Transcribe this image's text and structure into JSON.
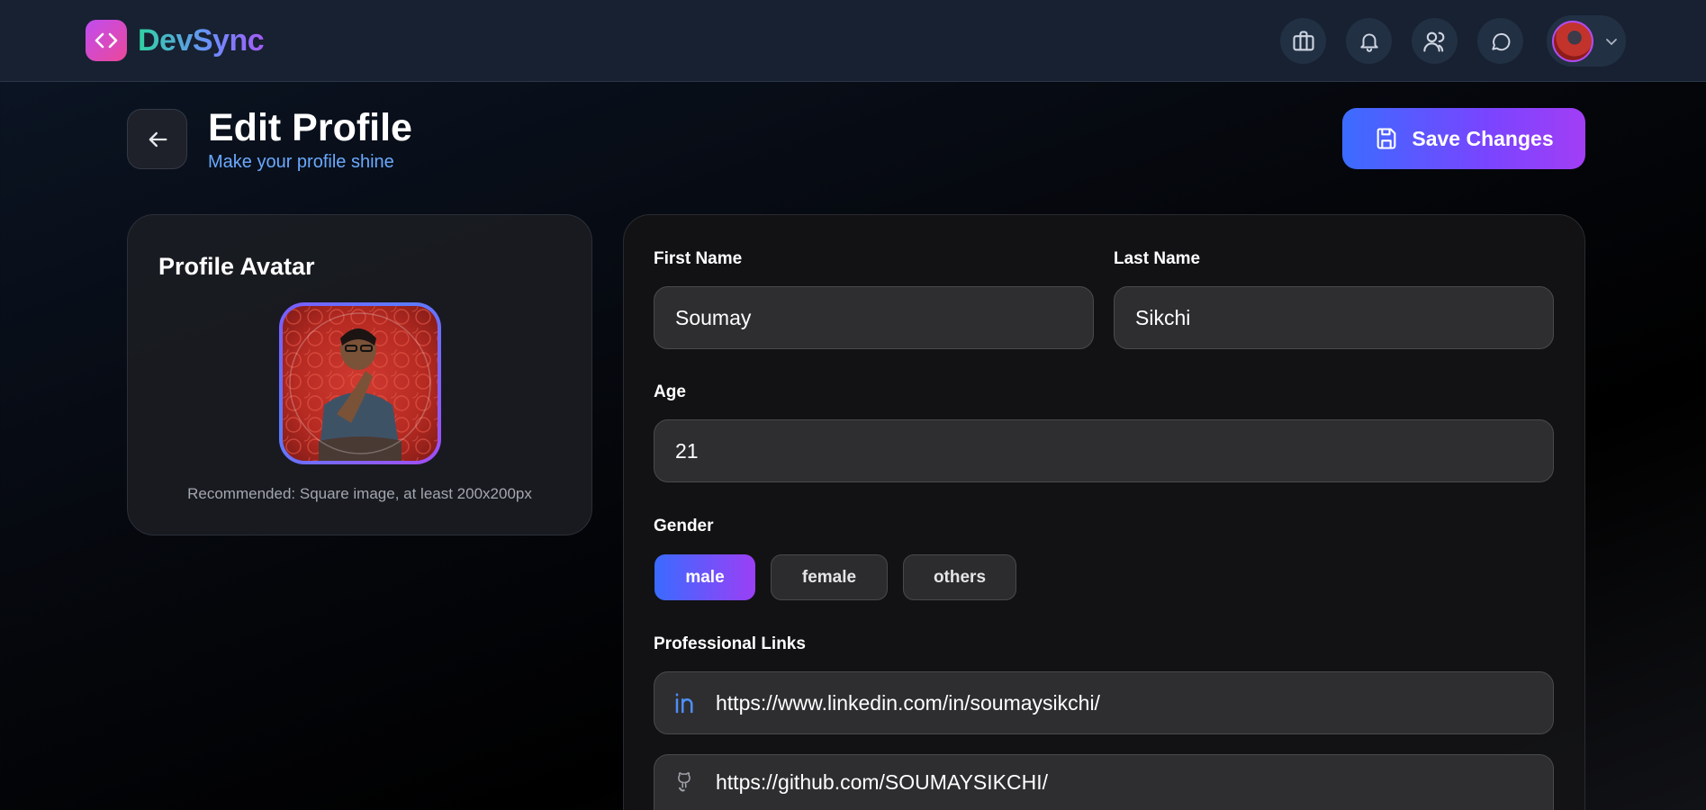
{
  "app": {
    "name": "DevSync"
  },
  "header": {
    "title": "Edit Profile",
    "subtitle": "Make your profile shine",
    "save_label": "Save Changes"
  },
  "nav": {
    "icons": [
      "briefcase-icon",
      "bell-icon",
      "users-icon",
      "chat-icon"
    ]
  },
  "avatar_card": {
    "title": "Profile Avatar",
    "hint": "Recommended: Square image, at least 200x200px"
  },
  "form": {
    "first_name": {
      "label": "First Name",
      "value": "Soumay"
    },
    "last_name": {
      "label": "Last Name",
      "value": "Sikchi"
    },
    "age": {
      "label": "Age",
      "value": "21"
    },
    "gender": {
      "label": "Gender",
      "options": [
        "male",
        "female",
        "others"
      ],
      "selected": "male"
    },
    "links": {
      "label": "Professional Links",
      "linkedin": "https://www.linkedin.com/in/soumaysikchi/",
      "github": "https://github.com/SOUMAYSIKCHI/"
    }
  },
  "colors": {
    "accent_blue": "#3b6cff",
    "accent_purple": "#a23ef5",
    "subtitle": "#6aa9ff"
  }
}
